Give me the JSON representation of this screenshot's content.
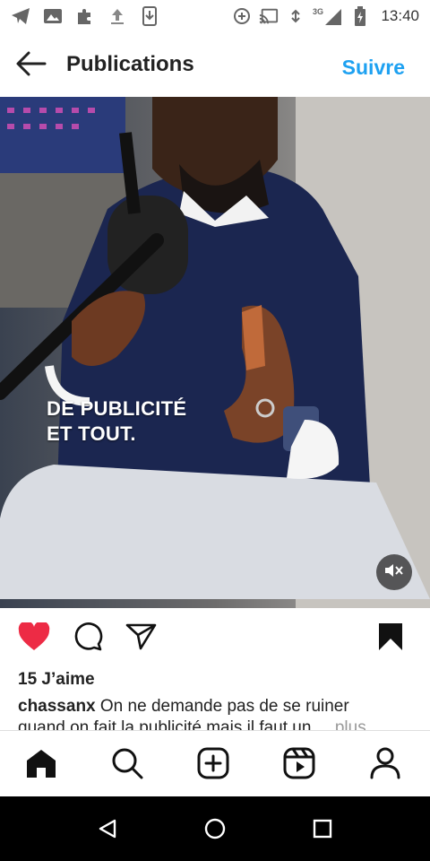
{
  "status_bar": {
    "time": "13:40",
    "network": "3G",
    "left_icons": [
      "telegram-icon",
      "gallery-icon",
      "puzzle-icon",
      "upload-icon",
      "download-icon"
    ],
    "right_icons": [
      "data-saver-icon",
      "cast-icon",
      "wifi-icon",
      "signal-icon",
      "battery-icon"
    ]
  },
  "header": {
    "title": "Publications",
    "follow_label": "Suivre"
  },
  "media": {
    "overlay_line1": "DE PUBLICITÉ",
    "overlay_line2": "ET TOUT."
  },
  "post": {
    "liked": true,
    "likes_text": "15 J’aime",
    "username": "chassanx",
    "caption_line1": "On ne demande pas de se ruiner",
    "caption_line2": "quand on fait la publicité mais il faut un",
    "more_label": "... plus"
  },
  "colors": {
    "accent": "#1ea1f1",
    "like": "#ed2b45"
  }
}
